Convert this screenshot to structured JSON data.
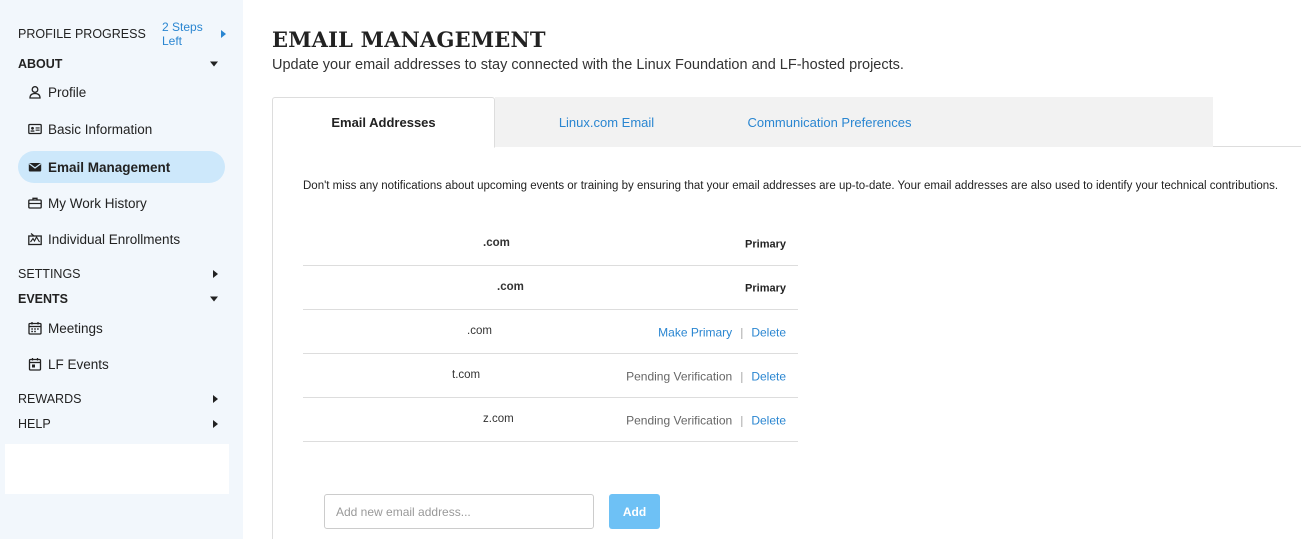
{
  "sidebar": {
    "profile_progress": {
      "label": "PROFILE PROGRESS",
      "steps_left": "2 Steps Left"
    },
    "about": {
      "label": "ABOUT",
      "items": [
        {
          "label": "Profile",
          "icon": "user-icon"
        },
        {
          "label": "Basic Information",
          "icon": "id-card-icon"
        },
        {
          "label": "Email Management",
          "icon": "envelope-icon"
        },
        {
          "label": "My Work History",
          "icon": "briefcase-icon"
        },
        {
          "label": "Individual Enrollments",
          "icon": "signature-icon"
        }
      ]
    },
    "settings": {
      "label": "SETTINGS"
    },
    "events": {
      "label": "EVENTS",
      "items": [
        {
          "label": "Meetings",
          "icon": "calendar-icon"
        },
        {
          "label": "LF Events",
          "icon": "calendar-event-icon"
        }
      ]
    },
    "rewards": {
      "label": "REWARDS"
    },
    "help": {
      "label": "HELP"
    }
  },
  "main": {
    "title": "EMAIL MANAGEMENT",
    "subtitle": "Update your email addresses to stay connected with the Linux Foundation and LF-hosted projects.",
    "tabs": [
      {
        "label": "Email Addresses",
        "active": true
      },
      {
        "label": "Linux.com Email",
        "active": false
      },
      {
        "label": "Communication Preferences",
        "active": false
      }
    ],
    "intro": "Don't miss any notifications about upcoming events or training by ensuring that your email addresses are up-to-date. Your email addresses are also used to identify your technical contributions.",
    "emails": [
      {
        "address": ".com",
        "status": "Primary"
      },
      {
        "address": ".com",
        "status": "Primary"
      },
      {
        "address": ".com",
        "action": "Make Primary",
        "delete": "Delete"
      },
      {
        "address": "t.com",
        "status": "Pending Verification",
        "delete": "Delete"
      },
      {
        "address": "z.com",
        "status": "Pending Verification",
        "delete": "Delete"
      }
    ],
    "add_email": {
      "placeholder": "Add new email address...",
      "button": "Add"
    }
  },
  "colors": {
    "accent": "#2a86d1",
    "active_nav_bg": "#cde8fb",
    "add_button_bg": "#6ec1f5",
    "sidebar_bg": "#f2f7fc"
  }
}
